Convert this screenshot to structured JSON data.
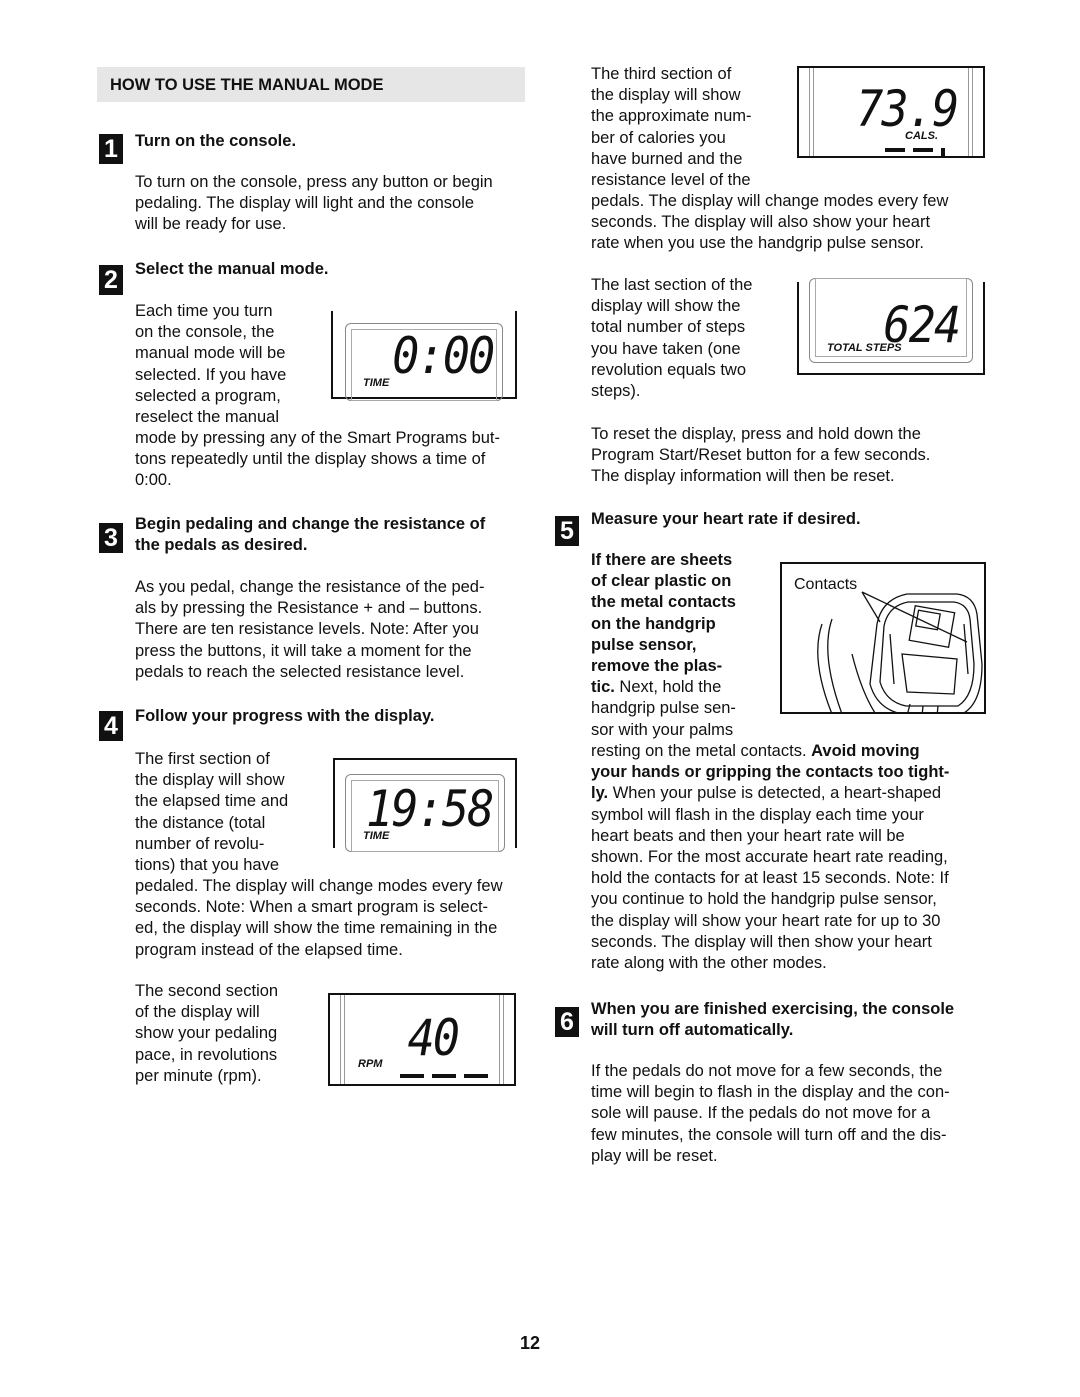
{
  "section_header": "HOW TO USE THE MANUAL MODE",
  "steps": [
    {
      "number": "1",
      "title": "Turn on the console.",
      "lines": [
        "To turn on the console, press any button or begin",
        "pedaling. The display will light and the console",
        "will be ready for use."
      ]
    },
    {
      "number": "2",
      "title": "Select the manual mode.",
      "lines_beside": [
        "Each time you turn",
        "on the console, the",
        "manual mode will be",
        "selected. If you have",
        "selected a program,",
        "reselect the manual"
      ],
      "lines": [
        "mode by pressing any of the Smart Programs but-",
        "tons repeatedly until the display shows a time of",
        "0:00."
      ],
      "display": {
        "value": "0:00",
        "unit": "TIME"
      }
    },
    {
      "number": "3",
      "title_lines": [
        "Begin pedaling and change the resistance of",
        "the pedals as desired."
      ],
      "lines": [
        "As you pedal, change the resistance of the ped-",
        "als by pressing the Resistance + and – buttons.",
        "There are ten resistance levels. Note: After you",
        "press the buttons, it will take a moment for the",
        "pedals to reach the selected resistance level."
      ]
    },
    {
      "number": "4",
      "title": "Follow your progress with the display.",
      "first": {
        "lines_beside": [
          "The first section of",
          "the display will show",
          "the elapsed time and",
          "the distance (total",
          "number of revolu-",
          "tions) that you have"
        ],
        "lines": [
          "pedaled. The display will change modes every few",
          "seconds. Note: When a smart program is select-",
          "ed, the display will show the time remaining in the",
          "program instead of the elapsed time."
        ],
        "display": {
          "value": "19:58",
          "unit": "TIME"
        }
      },
      "second": {
        "lines_beside": [
          "The second section",
          "of the display will",
          "show your pedaling",
          "pace, in revolutions",
          "per minute (rpm)."
        ],
        "display": {
          "value": "40",
          "unit": "RPM"
        }
      },
      "third": {
        "lines_beside": [
          "The third section of",
          "the display will show",
          "the approximate num-",
          "ber of calories you",
          "have burned and the",
          "resistance level of the"
        ],
        "lines": [
          "pedals. The display will change modes every few",
          "seconds. The display will also show your heart",
          "rate when you use the handgrip pulse sensor."
        ],
        "display": {
          "value": "73.9",
          "unit": "CALS."
        }
      },
      "last": {
        "lines_beside": [
          "The last section of the",
          "display will show the",
          "total number of steps",
          "you have taken (one",
          "revolution equals two",
          "steps)."
        ],
        "display": {
          "value": "624",
          "unit": "TOTAL STEPS"
        }
      },
      "reset_lines": [
        "To reset the display, press and hold down the",
        "Program Start/Reset button for a few seconds.",
        "The display  information will then be reset."
      ]
    },
    {
      "number": "5",
      "title": "Measure your heart rate if desired.",
      "bold_beside": [
        "If there are sheets",
        "of clear plastic on",
        "the metal contacts",
        "on the handgrip",
        "pulse sensor,",
        "remove the plas-"
      ],
      "mixed_line": {
        "bold": "tic.",
        "normal": " Next, hold the"
      },
      "lines_beside": [
        "handgrip pulse sen-",
        "sor with your palms"
      ],
      "line_a": {
        "normal": "resting on the metal contacts. ",
        "bold": "Avoid moving"
      },
      "line_b_bold": "your hands or gripping the contacts too tight-",
      "line_c": {
        "bold": "ly.",
        "normal": " When your pulse is detected, a heart-shaped"
      },
      "lines": [
        "symbol will flash in the display each time your",
        "heart beats and then your heart rate will be",
        "shown. For the most accurate heart rate reading,",
        "hold the contacts for at least 15 seconds. Note: If",
        "you continue to hold the handgrip pulse sensor,",
        "the display will show your heart rate for up to 30",
        "seconds. The display will then show your heart",
        "rate along with the other modes."
      ],
      "figure_label": "Contacts"
    },
    {
      "number": "6",
      "title_lines": [
        "When you are finished exercising, the console",
        "will turn off automatically."
      ],
      "lines": [
        "If the pedals do not move for a few seconds, the",
        "time will begin to flash in the display and the con-",
        "sole will pause. If the pedals do not move for a",
        "few minutes, the console will turn off and the dis-",
        "play will be reset."
      ]
    }
  ],
  "page_number": "12"
}
